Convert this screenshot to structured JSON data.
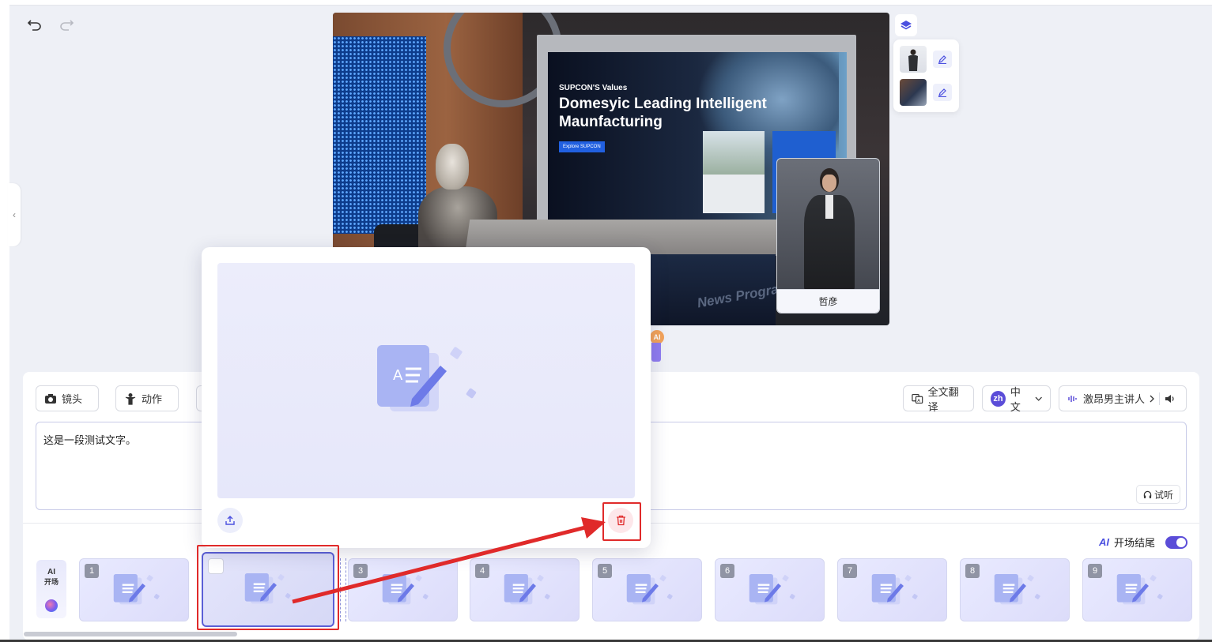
{
  "toolbar": {
    "undo_icon": "undo-icon",
    "redo_icon": "redo-icon"
  },
  "stage": {
    "screen_small": "SUPCON'S Values",
    "screen_title": "Domesyic Leading Intelligent Maunfacturing",
    "screen_button": "Explore SUPCON",
    "desk_text": "News Program Tit",
    "presenter_name": "哲彦"
  },
  "layers": {
    "icon": "layers-icon",
    "items": [
      {
        "name": "presenter-layer",
        "edit_icon": "edit-icon"
      },
      {
        "name": "background-layer",
        "edit_icon": "edit-icon"
      }
    ]
  },
  "editor": {
    "tools": {
      "camera_label": "镜头",
      "action_label": "动作",
      "translate_label": "全文翻译",
      "lang_code": "zh",
      "lang_label": "中文",
      "voice_label": "激昂男主讲人"
    },
    "text": "这是一段测试文字。",
    "listen_label": "试听",
    "opening_ending_label": "开场结尾",
    "opening_ending_on": true,
    "ai_open": {
      "line1": "AI",
      "line2": "开场"
    }
  },
  "clips": [
    {
      "num": "1"
    },
    {
      "num": "",
      "selected": true
    },
    {
      "num": "3"
    },
    {
      "num": "4"
    },
    {
      "num": "5"
    },
    {
      "num": "6"
    },
    {
      "num": "7"
    },
    {
      "num": "8"
    },
    {
      "num": "9"
    }
  ],
  "popup": {
    "upload_icon": "upload-icon",
    "delete_icon": "trash-icon"
  },
  "colors": {
    "accent": "#5b4dd8",
    "highlight": "#e02a2a",
    "delete_bg": "#fde7ea"
  }
}
